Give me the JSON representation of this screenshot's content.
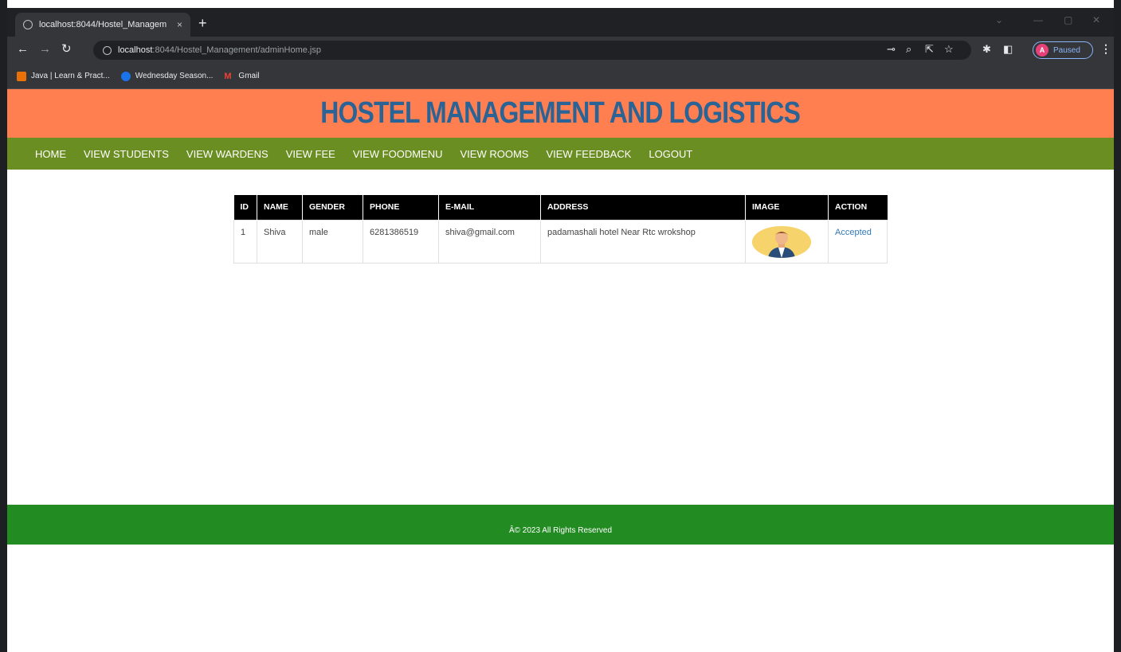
{
  "browser": {
    "tab_title": "localhost:8044/Hostel_Managem",
    "tab_close": "×",
    "new_tab": "+",
    "url_host": "localhost",
    "url_rest": ":8044/Hostel_Management/adminHome.jsp",
    "profile_initial": "A",
    "profile_status": "Paused",
    "bookmarks": [
      {
        "label": "Java | Learn & Pract...",
        "icon": "javatpoint-icon",
        "color": "#e8710a"
      },
      {
        "label": "Wednesday Season...",
        "icon": "video-icon",
        "color": "#1a73e8"
      },
      {
        "label": "Gmail",
        "icon": "gmail-icon",
        "color": "#ea4335"
      }
    ]
  },
  "site": {
    "title": "HOSTEL MANAGEMENT AND LOGISTICS",
    "nav": [
      "HOME",
      "VIEW STUDENTS",
      "VIEW WARDENS",
      "VIEW FEE",
      "VIEW FOODMENU",
      "VIEW ROOMS",
      "VIEW FEEDBACK",
      "LOGOUT"
    ],
    "footer": "Â© 2023 All Rights Reserved",
    "colors": {
      "header": "#ff7f50",
      "title": "#2a6496",
      "nav": "#6b8e23",
      "footer": "#228b22"
    }
  },
  "table": {
    "headers": [
      "ID",
      "NAME",
      "GENDER",
      "PHONE",
      "E-MAIL",
      "ADDRESS",
      "IMAGE",
      "ACTION"
    ],
    "rows": [
      {
        "id": "1",
        "name": "Shiva",
        "gender": "male",
        "phone": "6281386519",
        "email": "shiva@gmail.com",
        "address": "padamashali hotel Near Rtc wrokshop",
        "image": "student-avatar",
        "action": "Accepted"
      }
    ]
  }
}
